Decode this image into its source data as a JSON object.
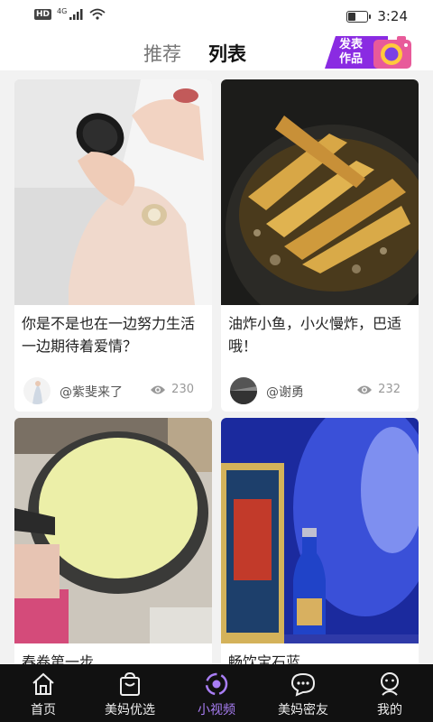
{
  "status_bar": {
    "hd": "HD",
    "network": "4G",
    "time": "3:24",
    "battery_level": 0.4
  },
  "header": {
    "tabs": [
      "推荐",
      "列表"
    ],
    "active_tab": "列表",
    "publish_label": "发表作品"
  },
  "cards": [
    {
      "title": "你是不是也在一边努力生活一边期待着爱情？",
      "author": "@紫斐来了",
      "views": "230"
    },
    {
      "title": "油炸小鱼，小火慢炸，巴适哦！",
      "author": "@谢勇",
      "views": "232"
    },
    {
      "title": "春卷第一步",
      "author": "",
      "views": ""
    },
    {
      "title": "畅饮宝石蓝",
      "author": "",
      "views": ""
    }
  ],
  "nav": {
    "items": [
      "首页",
      "美妈优选",
      "小视频",
      "美妈密友",
      "我的"
    ],
    "active": "小视频"
  },
  "colors": {
    "accent": "#8a2be2",
    "nav_active": "#a97ef5",
    "nav_bg": "#111111"
  }
}
